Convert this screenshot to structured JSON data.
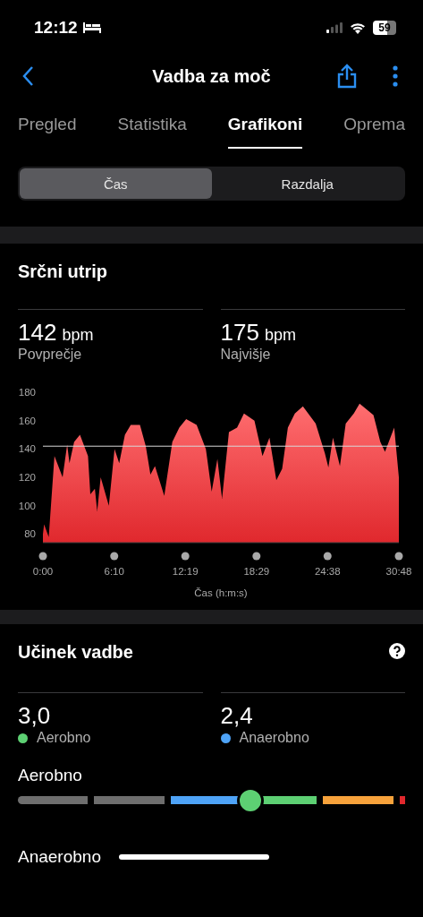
{
  "status_bar": {
    "time": "12:12",
    "battery": "59"
  },
  "nav": {
    "title": "Vadba za moč"
  },
  "tabs": [
    {
      "label": "Pregled",
      "selected": false
    },
    {
      "label": "Statistika",
      "selected": false
    },
    {
      "label": "Grafikoni",
      "selected": true
    },
    {
      "label": "Oprema",
      "selected": false
    }
  ],
  "segmented": [
    {
      "label": "Čas",
      "selected": true
    },
    {
      "label": "Razdalja",
      "selected": false
    }
  ],
  "heart_rate": {
    "title": "Srčni utrip",
    "stats": [
      {
        "value": "142",
        "unit": "bpm",
        "label": "Povprečje"
      },
      {
        "value": "175",
        "unit": "bpm",
        "label": "Najvišje"
      }
    ],
    "chart_data": {
      "type": "area",
      "xlabel": "Čas (h:m:s)",
      "x": [
        0,
        0.1,
        0.5,
        1.0,
        1.7,
        2.1,
        2.3,
        2.7,
        3.2,
        3.9,
        4.1,
        4.5,
        4.7,
        5.0,
        5.7,
        6.2,
        6.6,
        7.1,
        7.6,
        8.4,
        8.9,
        9.3,
        9.7,
        10.5,
        11.2,
        11.8,
        12.4,
        13.3,
        14.1,
        14.6,
        15.1,
        15.5,
        16.1,
        16.8,
        17.4,
        18.3,
        19.0,
        19.6,
        20.2,
        20.7,
        21.2,
        21.8,
        22.5,
        23.6,
        24.4,
        24.7,
        25.1,
        25.7,
        26.2,
        26.9,
        27.4,
        28.6,
        29.2,
        29.6,
        30.4,
        30.8
      ],
      "series": [
        {
          "color": "#e0282d",
          "values": [
            80,
            87,
            78,
            135,
            120,
            143,
            130,
            145,
            150,
            135,
            108,
            112,
            96,
            120,
            100,
            140,
            130,
            150,
            157,
            157,
            142,
            122,
            128,
            107,
            145,
            155,
            161,
            157,
            140,
            110,
            133,
            105,
            152,
            155,
            165,
            160,
            135,
            148,
            118,
            126,
            155,
            165,
            170,
            158,
            137,
            127,
            148,
            128,
            158,
            165,
            172,
            164,
            145,
            138,
            155,
            120
          ]
        }
      ],
      "xlim": [
        0,
        30.8
      ],
      "ylim": [
        74,
        180
      ],
      "yticks": [
        80,
        100,
        120,
        140,
        160,
        180
      ],
      "xticks": [
        {
          "value": 0,
          "label": "0:00"
        },
        {
          "value": 6.17,
          "label": "6:10"
        },
        {
          "value": 12.32,
          "label": "12:19"
        },
        {
          "value": 18.48,
          "label": "18:29"
        },
        {
          "value": 24.63,
          "label": "24:38"
        },
        {
          "value": 30.8,
          "label": "30:48"
        }
      ]
    }
  },
  "training_effect": {
    "title": "Učinek vadbe",
    "stats": [
      {
        "value": "3,0",
        "label": "Aerobno",
        "color": "#5dd073"
      },
      {
        "value": "2,4",
        "label": "Anaerobno",
        "color": "#4ea3f7"
      }
    ],
    "aerobic": {
      "label": "Aerobno",
      "level": 0.6,
      "color": "#5dd073",
      "segments": [
        {
          "color": "#6e6e6e"
        },
        {
          "color": "#6e6e6e"
        },
        {
          "color": "#4ea3f7"
        },
        {
          "color": "#5dd073"
        },
        {
          "color": "#f7a23b"
        },
        {
          "color": "#e0282d"
        }
      ]
    },
    "anaerobic": {
      "label": "Anaerobno"
    }
  }
}
